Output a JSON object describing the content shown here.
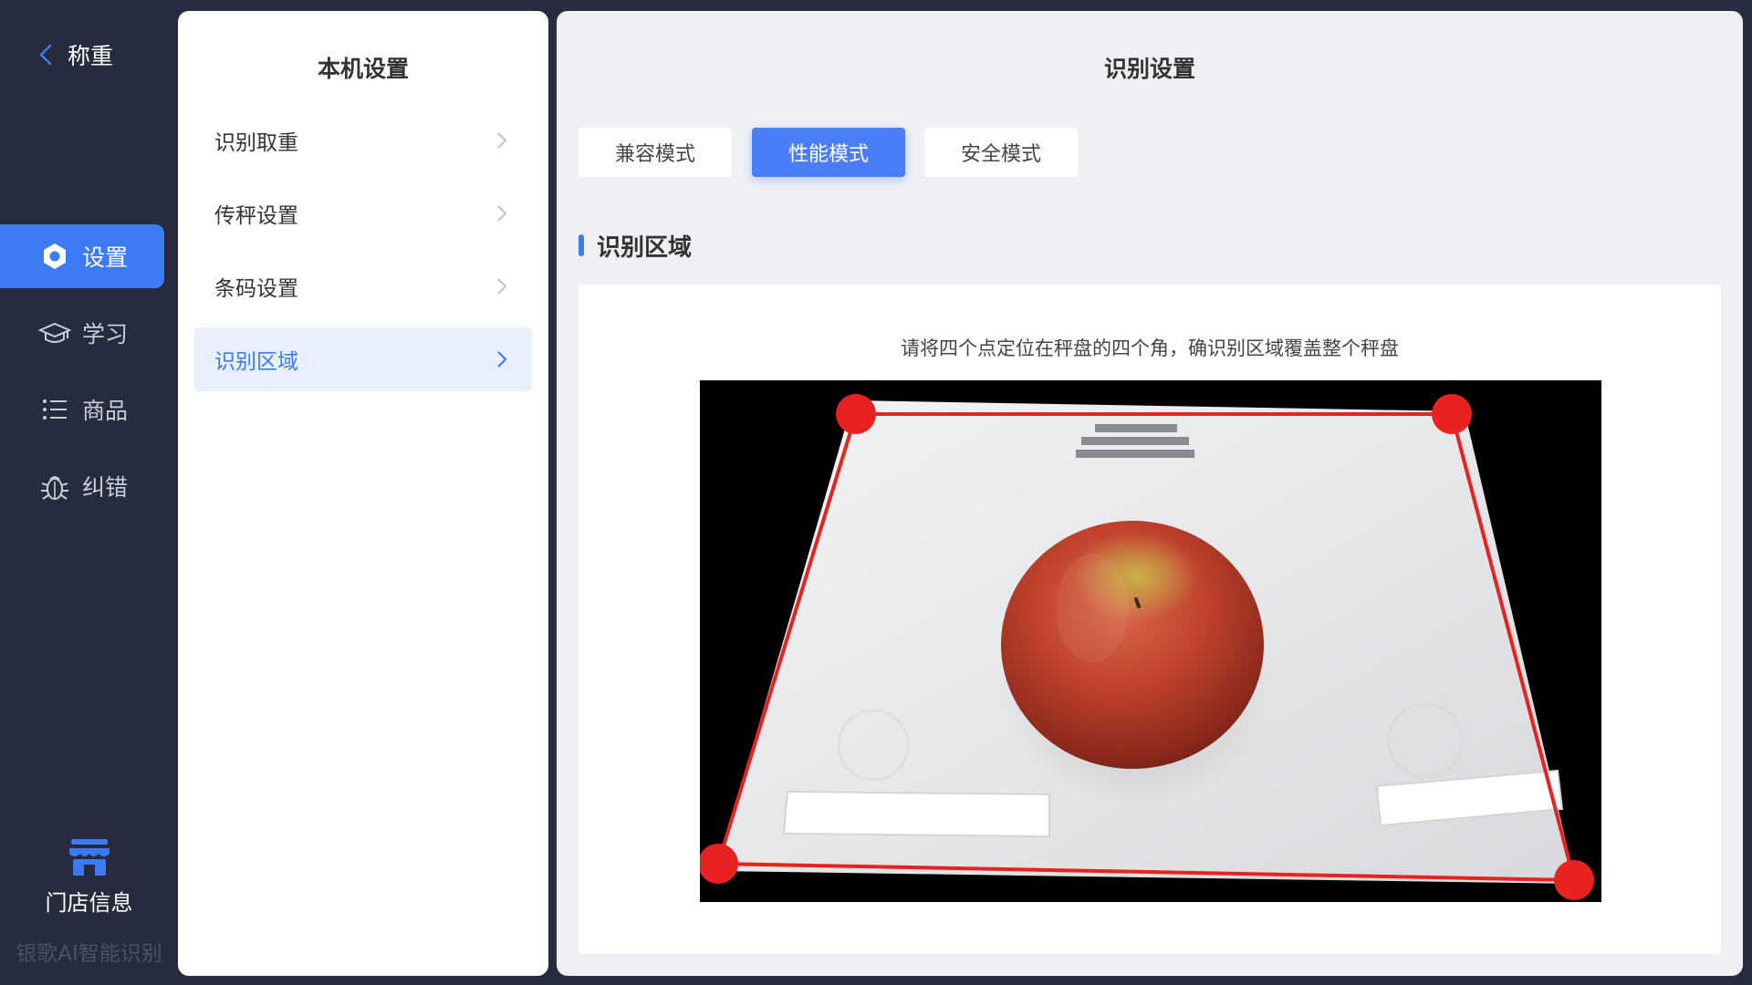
{
  "nav": {
    "back_label": "称重",
    "items": [
      {
        "label": "设置",
        "icon": "gear-icon",
        "active": true
      },
      {
        "label": "学习",
        "icon": "graduation-cap-icon",
        "active": false
      },
      {
        "label": "商品",
        "icon": "list-icon",
        "active": false
      },
      {
        "label": "纠错",
        "icon": "bug-icon",
        "active": false
      }
    ],
    "store_label": "门店信息",
    "brand": "银歌AI智能识别"
  },
  "settings_panel": {
    "title": "本机设置",
    "items": [
      {
        "label": "识别取重",
        "active": false
      },
      {
        "label": "传秤设置",
        "active": false
      },
      {
        "label": "条码设置",
        "active": false
      },
      {
        "label": "识别区域",
        "active": true
      }
    ]
  },
  "main": {
    "title": "识别设置",
    "modes": [
      {
        "label": "兼容模式",
        "active": false
      },
      {
        "label": "性能模式",
        "active": true
      },
      {
        "label": "安全模式",
        "active": false
      }
    ],
    "section_title": "识别区域",
    "hint": "请将四个点定位在秤盘的四个角，确识别区域覆盖整个秤盘"
  },
  "colors": {
    "nav_bg": "#262b3d",
    "accent": "#3d7bf5",
    "marker_red": "#e8231f"
  }
}
